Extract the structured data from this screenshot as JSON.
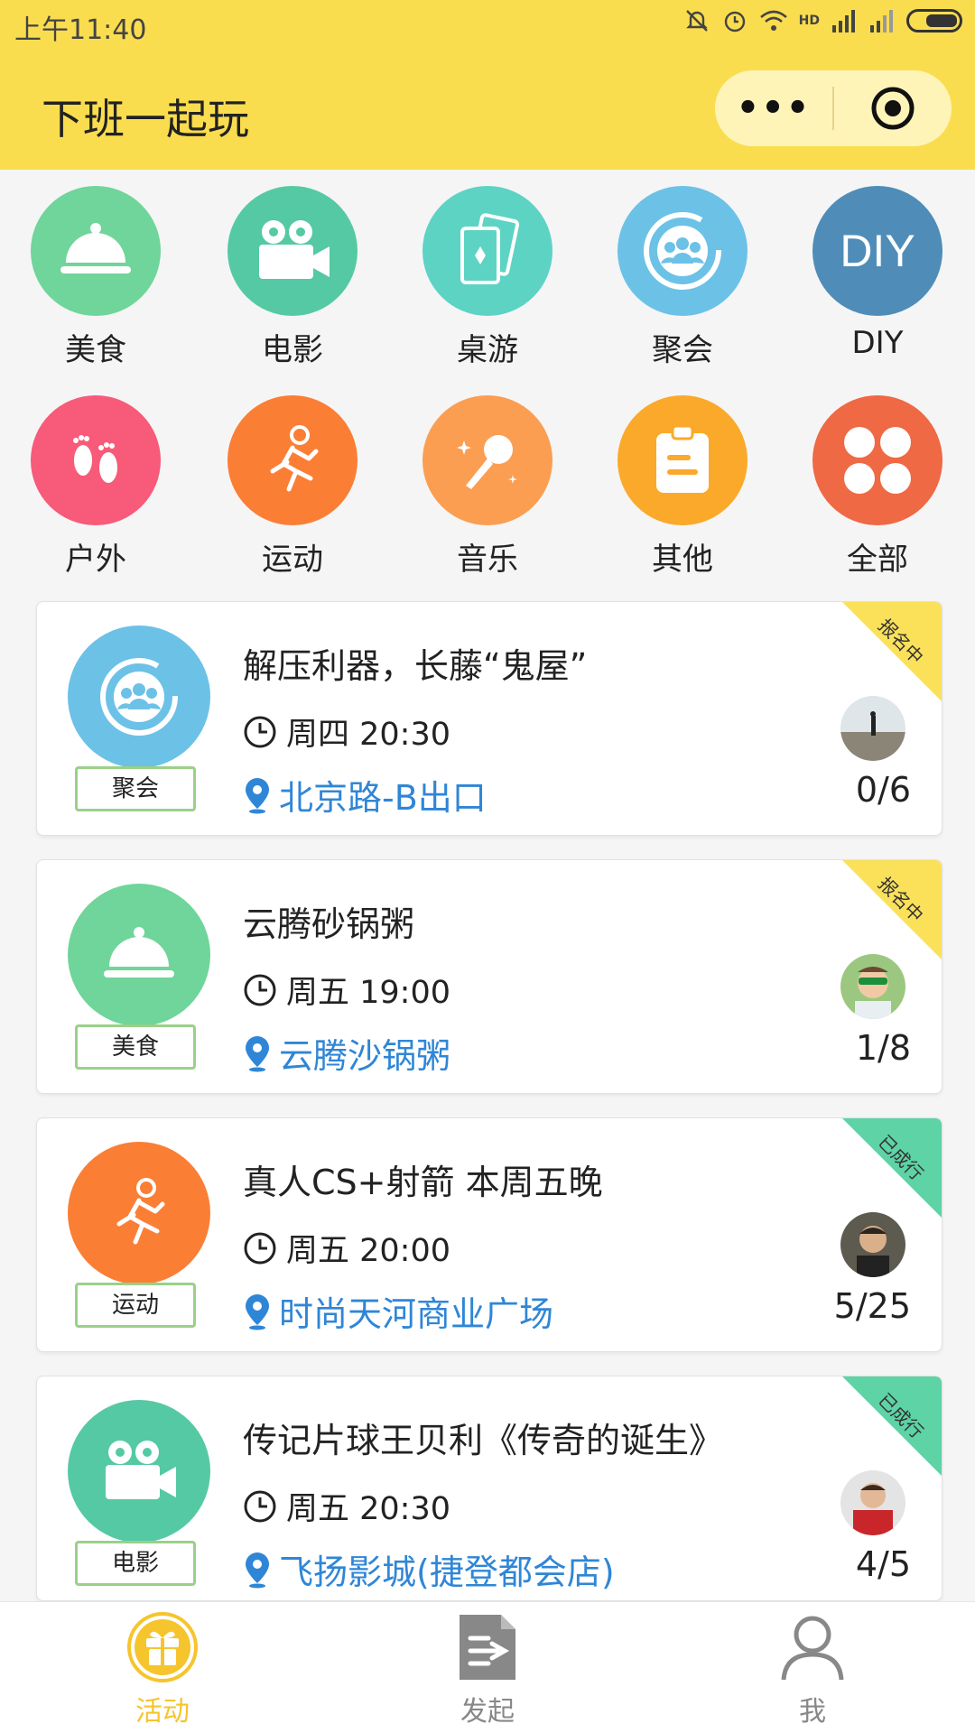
{
  "status_bar": {
    "time": "上午11:40",
    "hd_label": "HD"
  },
  "header": {
    "title": "下班一起玩",
    "more_label": "•••"
  },
  "categories": [
    {
      "label": "美食",
      "color": "#6fd59a",
      "icon": "food-cloche-icon"
    },
    {
      "label": "电影",
      "color": "#55c9a4",
      "icon": "movie-camera-icon"
    },
    {
      "label": "桌游",
      "color": "#5dd3c4",
      "icon": "cards-icon"
    },
    {
      "label": "聚会",
      "color": "#6cc1e7",
      "icon": "group-icon"
    },
    {
      "label": "DIY",
      "color": "#4f8db8",
      "icon": "diy-icon",
      "text": "DIY"
    },
    {
      "label": "户外",
      "color": "#f85a7a",
      "icon": "footprints-icon"
    },
    {
      "label": "运动",
      "color": "#fb7e35",
      "icon": "running-icon"
    },
    {
      "label": "音乐",
      "color": "#fb9e51",
      "icon": "microphone-icon"
    },
    {
      "label": "其他",
      "color": "#fba92b",
      "icon": "clipboard-icon"
    },
    {
      "label": "全部",
      "color": "#ee6944",
      "icon": "grid-icon"
    }
  ],
  "activities": [
    {
      "title": "解压利器，长藤“鬼屋”",
      "category": "聚会",
      "time": "周四 20:30",
      "location": "北京路-B出口",
      "count": "0/6",
      "status": "报名中",
      "status_color": "#fbe15a",
      "icon_color": "#6cc1e7",
      "icon": "group-icon"
    },
    {
      "title": "云腾砂锅粥",
      "category": "美食",
      "time": "周五 19:00",
      "location": "云腾沙锅粥",
      "count": "1/8",
      "status": "报名中",
      "status_color": "#fbe15a",
      "icon_color": "#6fd59a",
      "icon": "food-cloche-icon"
    },
    {
      "title": "真人CS+射箭 本周五晚",
      "category": "运动",
      "time": "周五 20:00",
      "location": "时尚天河商业广场",
      "count": "5/25",
      "status": "已成行",
      "status_color": "#5dd3a6",
      "icon_color": "#fb7e35",
      "icon": "running-icon"
    },
    {
      "title": "传记片球王贝利《传奇的诞生》",
      "category": "电影",
      "time": "周五 20:30",
      "location": "飞扬影城(捷登都会店)",
      "count": "4/5",
      "status": "已成行",
      "status_color": "#5dd3a6",
      "icon_color": "#55c9a4",
      "icon": "movie-camera-icon"
    }
  ],
  "bottom_nav": [
    {
      "label": "活动",
      "active": true,
      "icon": "gift-icon"
    },
    {
      "label": "发起",
      "active": false,
      "icon": "publish-icon"
    },
    {
      "label": "我",
      "active": false,
      "icon": "user-icon"
    }
  ],
  "colors": {
    "header_bg": "#fadd4f",
    "link": "#2f86d6",
    "nav_active": "#f6c42c",
    "nav_inactive": "#888888"
  }
}
